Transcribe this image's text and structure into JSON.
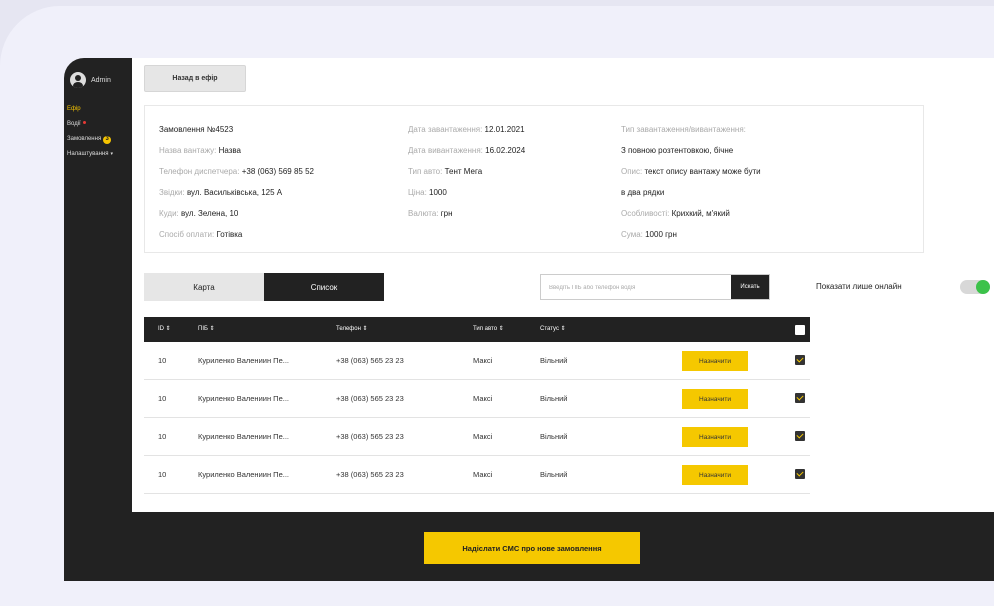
{
  "sidebar": {
    "user": "Admin",
    "items": [
      {
        "label": "Ефір",
        "active": true
      },
      {
        "label": "Водії",
        "dot": true
      },
      {
        "label": "Замовлення",
        "badge": "3"
      },
      {
        "label": "Налаштування",
        "caret": "▾"
      }
    ]
  },
  "header": {
    "back_label": "Назад в ефір"
  },
  "order": {
    "title": "Замовлення №4523",
    "cargo_name_label": "Назва вантажу:",
    "cargo_name": "Назва",
    "dispatcher_phone_label": "Телефон диспетчера:",
    "dispatcher_phone": "+38 (063) 569 85 52",
    "from_label": "Звідки:",
    "from": "вул. Васильківська, 125 А",
    "to_label": "Куди:",
    "to": "вул. Зелена, 10",
    "payment_label": "Спосіб оплати:",
    "payment": "Готівка",
    "loading_date_label": "Дата завантаження:",
    "loading_date": "12.01.2021",
    "unloading_date_label": "Дата вивантаження:",
    "unloading_date": "16.02.2024",
    "vehicle_type_label": "Тип авто:",
    "vehicle_type": "Тент Мега",
    "price_label": "Ціна:",
    "price": "1000",
    "currency_label": "Валюта:",
    "currency": "грн",
    "load_type_label": "Тип завантаження/вивантаження:",
    "load_type": "З повною розтентовкою, бічне",
    "description_label": "Опис:",
    "description_1": "текст опису вантажу може бути",
    "description_2": "в два рядки",
    "features_label": "Особливості:",
    "features": "Крихкий, м'який",
    "sum_label": "Сума:",
    "sum": "1000 грн"
  },
  "view_toggle": {
    "map": "Карта",
    "list": "Список"
  },
  "search": {
    "placeholder": "Введіть ПІБ або телефон водія",
    "button": "Искать"
  },
  "online_only_label": "Показати лише онлайн",
  "online_only_on": true,
  "table": {
    "headers": {
      "id": "ID ⇕",
      "name": "ПІБ ⇕",
      "phone": "Телефон ⇕",
      "vehicle": "Тип авто ⇕",
      "status": "Статус ⇕"
    },
    "rows": [
      {
        "id": "10",
        "name": "Куриленко Валениин Пе...",
        "phone": "+38 (063) 565 23 23",
        "vehicle": "Максі",
        "status": "Вільний",
        "action": "Назначити",
        "checked": true
      },
      {
        "id": "10",
        "name": "Куриленко Валениин Пе...",
        "phone": "+38 (063) 565 23 23",
        "vehicle": "Максі",
        "status": "Вільний",
        "action": "Назначити",
        "checked": true
      },
      {
        "id": "10",
        "name": "Куриленко Валениин Пе...",
        "phone": "+38 (063) 565 23 23",
        "vehicle": "Максі",
        "status": "Вільний",
        "action": "Назначити",
        "checked": true
      },
      {
        "id": "10",
        "name": "Куриленко Валениин Пе...",
        "phone": "+38 (063) 565 23 23",
        "vehicle": "Максі",
        "status": "Вільний",
        "action": "Назначити",
        "checked": true
      }
    ]
  },
  "footer": {
    "sms_button": "Надіслати СМС про нове замовлення"
  },
  "colors": {
    "accent": "#f5c800",
    "dark": "#222222",
    "online": "#3cc24a"
  }
}
